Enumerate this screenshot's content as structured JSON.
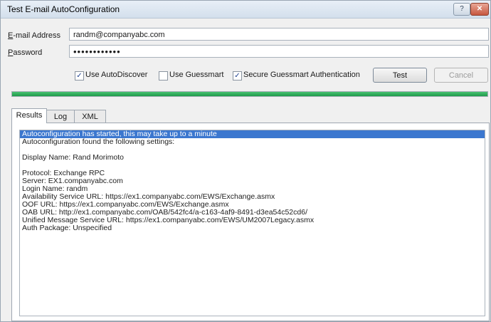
{
  "window": {
    "title": "Test E-mail AutoConfiguration",
    "help_label": "?",
    "close_label": "✕"
  },
  "form": {
    "email_label": "-mail Address",
    "email_label_ul": "E",
    "email_value": "randm@companyabc.com",
    "password_label": "assword",
    "password_label_ul": "P",
    "password_value": "••••••••••••"
  },
  "options": {
    "use_autodiscover": {
      "label": "Use AutoDiscover",
      "checked": true
    },
    "use_guessmart": {
      "label": "Use Guessmart",
      "checked": false
    },
    "secure_guessmart": {
      "label": "Secure Guessmart Authentication",
      "checked": true
    },
    "check_glyph": "✓"
  },
  "buttons": {
    "test": "Test",
    "cancel": "Cancel"
  },
  "progress": {
    "value": 1.0,
    "color": "#2aa556"
  },
  "tabs": [
    {
      "label": "Results",
      "active": true
    },
    {
      "label": "Log",
      "active": false
    },
    {
      "label": "XML",
      "active": false
    }
  ],
  "results": [
    "Autoconfiguration has started, this may take up to a minute",
    "Autoconfiguration found the following settings:",
    "",
    "Display Name: Rand Morimoto",
    "",
    "Protocol: Exchange RPC",
    "Server: EX1.companyabc.com",
    "Login Name: randm",
    "Availability Service URL: https://ex1.companyabc.com/EWS/Exchange.asmx",
    "OOF URL: https://ex1.companyabc.com/EWS/Exchange.asmx",
    "OAB URL: http://ex1.companyabc.com/OAB/542fc4/a-c163-4af9-8491-d3ea54c52cd6/",
    "Unified Message Service URL: https://ex1.companyabc.com/EWS/UM2007Legacy.asmx",
    "Auth Package: Unspecified"
  ]
}
